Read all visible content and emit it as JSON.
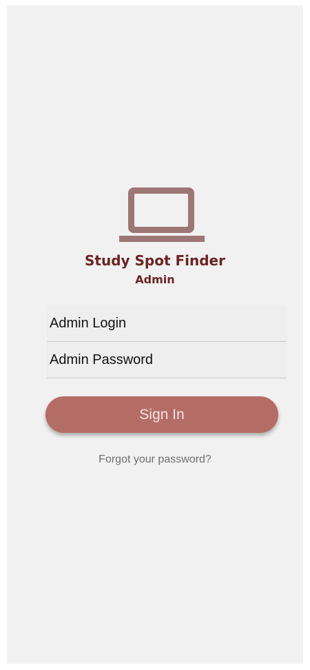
{
  "app": {
    "title": "Study Spot Finder",
    "subtitle": "Admin",
    "logo_icon": "laptop-icon",
    "brand_color": "#6b2424",
    "accent_color": "#b46d66"
  },
  "form": {
    "login_placeholder": "Admin Login",
    "login_value": "",
    "password_placeholder": "Admin Password",
    "password_value": "",
    "signin_label": "Sign In",
    "forgot_label": "Forgot your password?"
  }
}
